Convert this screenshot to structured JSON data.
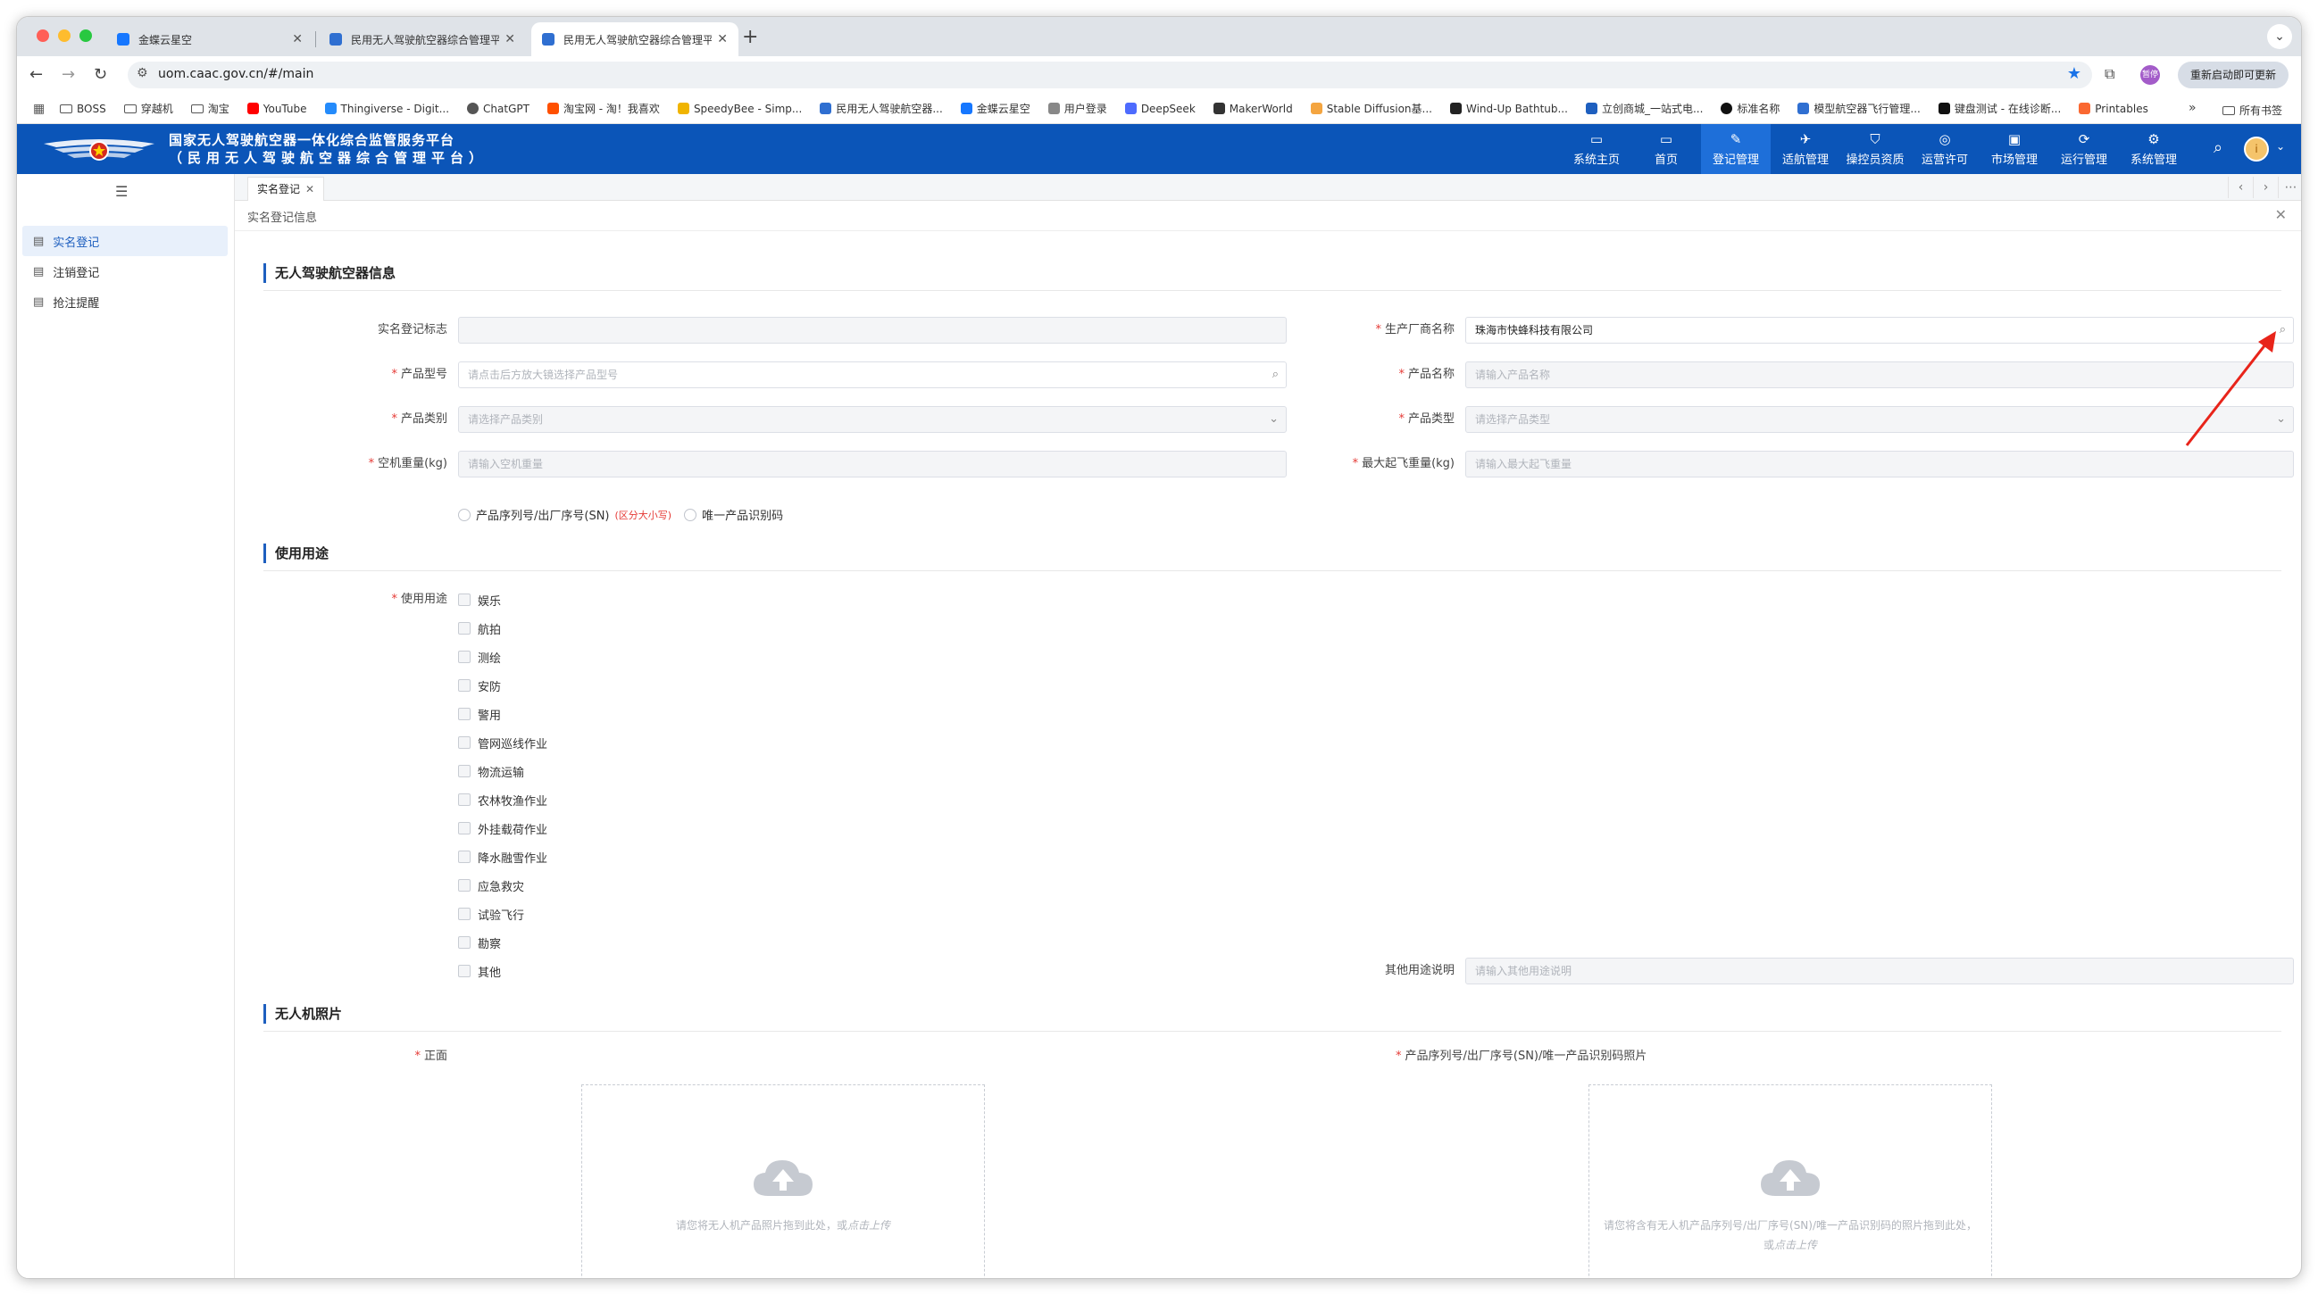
{
  "browser": {
    "tabs": [
      {
        "title": "金蝶云星空"
      },
      {
        "title": "民用无人驾驶航空器综合管理平"
      },
      {
        "title": "民用无人驾驶航空器综合管理平"
      }
    ],
    "url": "uom.caac.gov.cn/#/main",
    "profile_label": "暂停",
    "update_button": "重新启动即可更新",
    "bookmarks": [
      "BOSS",
      "穿越机",
      "淘宝",
      "YouTube",
      "Thingiverse - Digit...",
      "ChatGPT",
      "淘宝网 - 淘！我喜欢",
      "SpeedyBee - Simp...",
      "民用无人驾驶航空器...",
      "金蝶云星空",
      "用户登录",
      "DeepSeek",
      "MakerWorld",
      "Stable Diffusion基...",
      "Wind-Up Bathtub...",
      "立创商城_一站式电...",
      "标准名称",
      "模型航空器飞行管理...",
      "键盘测试 - 在线诊断...",
      "Printables"
    ],
    "all_bookmarks": "所有书签"
  },
  "app": {
    "title_line1": "国家无人驾驶航空器一体化综合监管服务平台",
    "title_line2": "（民用无人驾驶航空器综合管理平台）",
    "nav": [
      {
        "label": "系统主页",
        "icon": "monitor-icon"
      },
      {
        "label": "首页",
        "icon": "desktop-icon"
      },
      {
        "label": "登记管理",
        "icon": "register-icon",
        "active": true
      },
      {
        "label": "适航管理",
        "icon": "drone-icon"
      },
      {
        "label": "操控员资质",
        "icon": "shield-icon"
      },
      {
        "label": "运营许可",
        "icon": "permit-icon"
      },
      {
        "label": "市场管理",
        "icon": "market-icon"
      },
      {
        "label": "运行管理",
        "icon": "refresh-icon"
      },
      {
        "label": "系统管理",
        "icon": "settings-icon"
      }
    ],
    "avatar_letter": "i"
  },
  "sidebar": {
    "items": [
      {
        "label": "实名登记",
        "active": true
      },
      {
        "label": "注销登记"
      },
      {
        "label": "抢注提醒"
      }
    ]
  },
  "page_tab": {
    "label": "实名登记"
  },
  "breadcrumb": "实名登记信息",
  "form": {
    "section1": "无人驾驶航空器信息",
    "reg_mark": {
      "label": "实名登记标志",
      "value": ""
    },
    "manufacturer": {
      "label": "生产厂商名称",
      "value": "珠海市快蜂科技有限公司"
    },
    "model": {
      "label": "产品型号",
      "placeholder": "请点击后方放大镜选择产品型号"
    },
    "product_name": {
      "label": "产品名称",
      "placeholder": "请输入产品名称"
    },
    "category": {
      "label": "产品类别",
      "placeholder": "请选择产品类别"
    },
    "product_type": {
      "label": "产品类型",
      "placeholder": "请选择产品类型"
    },
    "empty_weight": {
      "label": "空机重量(kg)",
      "placeholder": "请输入空机重量"
    },
    "max_weight": {
      "label": "最大起飞重量(kg)",
      "placeholder": "请输入最大起飞重量"
    },
    "radio_sn": "产品序列号/出厂序号(SN)",
    "radio_sn_hint": "(区分大小写)",
    "radio_uid": "唯一产品识别码",
    "section2": "使用用途",
    "usage_label": "使用用途",
    "usages": [
      "娱乐",
      "航拍",
      "测绘",
      "安防",
      "警用",
      "管网巡线作业",
      "物流运输",
      "农林牧渔作业",
      "外挂载荷作业",
      "降水融雪作业",
      "应急救灾",
      "试验飞行",
      "勘察",
      "其他"
    ],
    "other_usage": {
      "label": "其他用途说明",
      "placeholder": "请输入其他用途说明"
    },
    "section3": "无人机照片",
    "photo_front": {
      "label": "正面",
      "hint": "请您将无人机产品照片拖到此处，或",
      "link": "点击上传"
    },
    "photo_sn": {
      "label": "产品序列号/出厂序号(SN)/唯一产品识别码照片",
      "hint": "请您将含有无人机产品序列号/出厂序号(SN)/唯一产品识别码的照片拖到此处，或",
      "link": "点击上传"
    }
  }
}
